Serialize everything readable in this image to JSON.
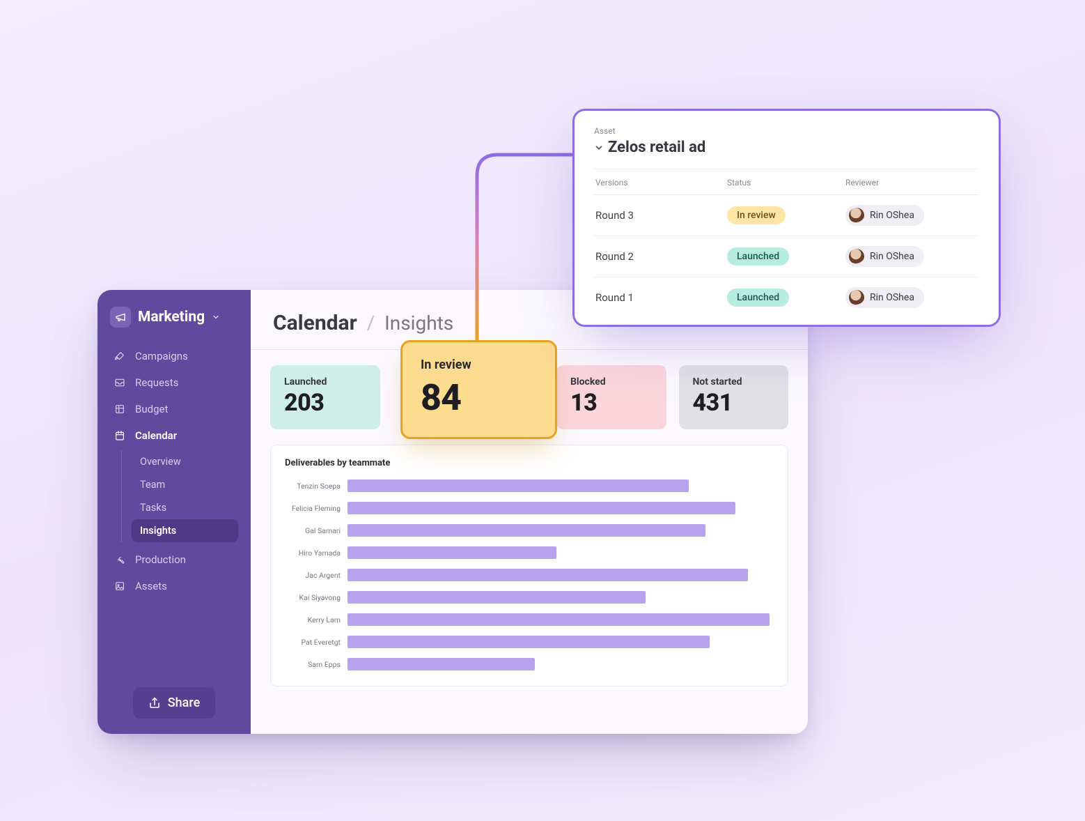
{
  "workspace": {
    "name": "Marketing"
  },
  "sidebar": {
    "items": [
      {
        "label": "Campaigns"
      },
      {
        "label": "Requests"
      },
      {
        "label": "Budget"
      },
      {
        "label": "Calendar"
      },
      {
        "label": "Production"
      },
      {
        "label": "Assets"
      }
    ],
    "calendar_sub": [
      {
        "label": "Overview"
      },
      {
        "label": "Team"
      },
      {
        "label": "Tasks"
      },
      {
        "label": "Insights"
      }
    ],
    "share_label": "Share"
  },
  "breadcrumb": {
    "main": "Calendar",
    "sub": "Insights"
  },
  "stats": {
    "launched": {
      "label": "Launched",
      "value": "203"
    },
    "in_review": {
      "label": "In review",
      "value": "84"
    },
    "blocked": {
      "label": "Blocked",
      "value": "13"
    },
    "not_started": {
      "label": "Not started",
      "value": "431"
    }
  },
  "chart_data": {
    "type": "bar",
    "title": "Deliverables by teammate",
    "xlabel": "",
    "ylabel": "",
    "ylim": [
      0,
      100
    ],
    "categories": [
      "Tenzin Soepa",
      "Felicia Fleming",
      "Gal Samari",
      "Hiro Yamada",
      "Jac Argent",
      "Kai Siyavong",
      "Kerry Lam",
      "Pat Everetgt",
      "Sam Epps"
    ],
    "values": [
      80,
      91,
      84,
      49,
      94,
      70,
      99,
      85,
      44
    ]
  },
  "asset_panel": {
    "meta_label": "Asset",
    "title": "Zelos retail ad",
    "columns": {
      "versions": "Versions",
      "status": "Status",
      "reviewer": "Reviewer"
    },
    "rows": [
      {
        "version": "Round 3",
        "status": "In review",
        "status_kind": "review",
        "reviewer": "Rin OShea"
      },
      {
        "version": "Round 2",
        "status": "Launched",
        "status_kind": "launched",
        "reviewer": "Rin OShea"
      },
      {
        "version": "Round 1",
        "status": "Launched",
        "status_kind": "launched",
        "reviewer": "Rin OShea"
      }
    ]
  }
}
